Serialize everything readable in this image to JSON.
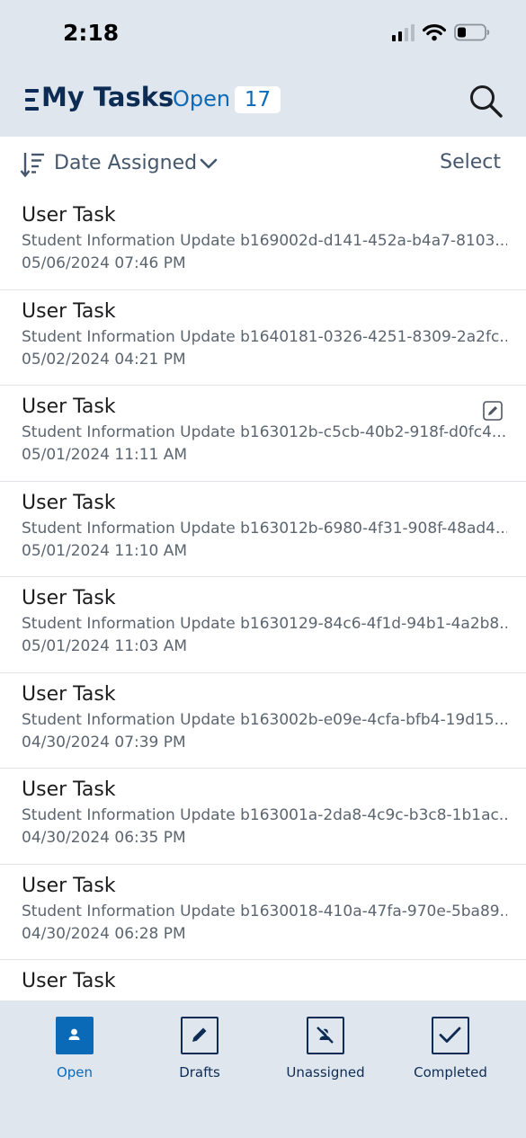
{
  "status_bar": {
    "time": "2:18"
  },
  "header": {
    "title": "My Tasks",
    "filter": "Open",
    "count": "17"
  },
  "sort": {
    "label": "Date Assigned",
    "select_label": "Select"
  },
  "tasks": [
    {
      "title": "User Task",
      "description": "Student Information Update b169002d-d141-452a-b4a7-8103...",
      "date": "05/06/2024 07:46 PM",
      "draft": false
    },
    {
      "title": "User Task",
      "description": "Student Information Update b1640181-0326-4251-8309-2a2fc...",
      "date": "05/02/2024 04:21 PM",
      "draft": false
    },
    {
      "title": "User Task",
      "description": "Student Information Update b163012b-c5cb-40b2-918f-d0fc4...",
      "date": "05/01/2024 11:11 AM",
      "draft": true
    },
    {
      "title": "User Task",
      "description": "Student Information Update b163012b-6980-4f31-908f-48ad4...",
      "date": "05/01/2024 11:10 AM",
      "draft": false
    },
    {
      "title": "User Task",
      "description": "Student Information Update b1630129-84c6-4f1d-94b1-4a2b8...",
      "date": "05/01/2024 11:03 AM",
      "draft": false
    },
    {
      "title": "User Task",
      "description": "Student Information Update b163002b-e09e-4cfa-bfb4-19d15...",
      "date": "04/30/2024 07:39 PM",
      "draft": false
    },
    {
      "title": "User Task",
      "description": "Student Information Update b163001a-2da8-4c9c-b3c8-1b1ac...",
      "date": "04/30/2024 06:35 PM",
      "draft": false
    },
    {
      "title": "User Task",
      "description": "Student Information Update b1630018-410a-47fa-970e-5ba89...",
      "date": "04/30/2024 06:28 PM",
      "draft": false
    },
    {
      "title": "User Task",
      "description": "",
      "date": "",
      "draft": false
    }
  ],
  "tabs": [
    {
      "label": "Open",
      "icon": "person-icon",
      "active": true
    },
    {
      "label": "Drafts",
      "icon": "pencil-icon",
      "active": false
    },
    {
      "label": "Unassigned",
      "icon": "unassigned-person-icon",
      "active": false
    },
    {
      "label": "Completed",
      "icon": "checkmark-icon",
      "active": false
    }
  ],
  "colors": {
    "header_bg": "#dfe6ee",
    "navy": "#0d2c54",
    "accent": "#0b6ab8",
    "muted_text": "#5b6570"
  }
}
